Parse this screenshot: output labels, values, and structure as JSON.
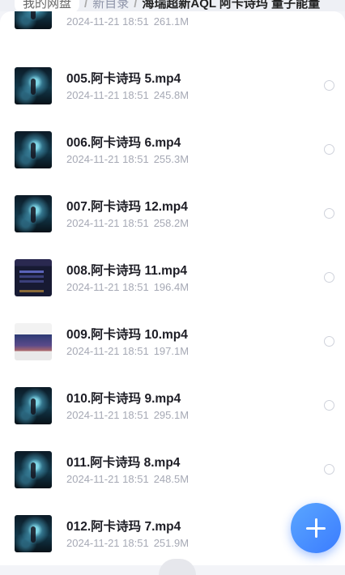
{
  "breadcrumb": {
    "root": "我的网盘",
    "folder": "新目录",
    "current": "海瑞超新AQL 阿卡诗玛 量子能量"
  },
  "files": [
    {
      "name": "",
      "date": "2024-11-21 18:51",
      "size": "261.1M",
      "thumb": "anime"
    },
    {
      "name": "005.阿卡诗玛 5.mp4",
      "date": "2024-11-21 18:51",
      "size": "245.8M",
      "thumb": "anime"
    },
    {
      "name": "006.阿卡诗玛 6.mp4",
      "date": "2024-11-21 18:51",
      "size": "255.3M",
      "thumb": "anime"
    },
    {
      "name": "007.阿卡诗玛 12.mp4",
      "date": "2024-11-21 18:51",
      "size": "258.2M",
      "thumb": "anime"
    },
    {
      "name": "008.阿卡诗玛 11.mp4",
      "date": "2024-11-21 18:51",
      "size": "196.4M",
      "thumb": "dark"
    },
    {
      "name": "009.阿卡诗玛 10.mp4",
      "date": "2024-11-21 18:51",
      "size": "197.1M",
      "thumb": "shot"
    },
    {
      "name": "010.阿卡诗玛 9.mp4",
      "date": "2024-11-21 18:51",
      "size": "295.1M",
      "thumb": "anime"
    },
    {
      "name": "011.阿卡诗玛 8.mp4",
      "date": "2024-11-21 18:51",
      "size": "248.5M",
      "thumb": "anime"
    },
    {
      "name": "012.阿卡诗玛 7.mp4",
      "date": "2024-11-21 18:51",
      "size": "251.9M",
      "thumb": "anime"
    }
  ],
  "fab": {
    "icon": "plus-icon",
    "color": "#3b7cff"
  }
}
